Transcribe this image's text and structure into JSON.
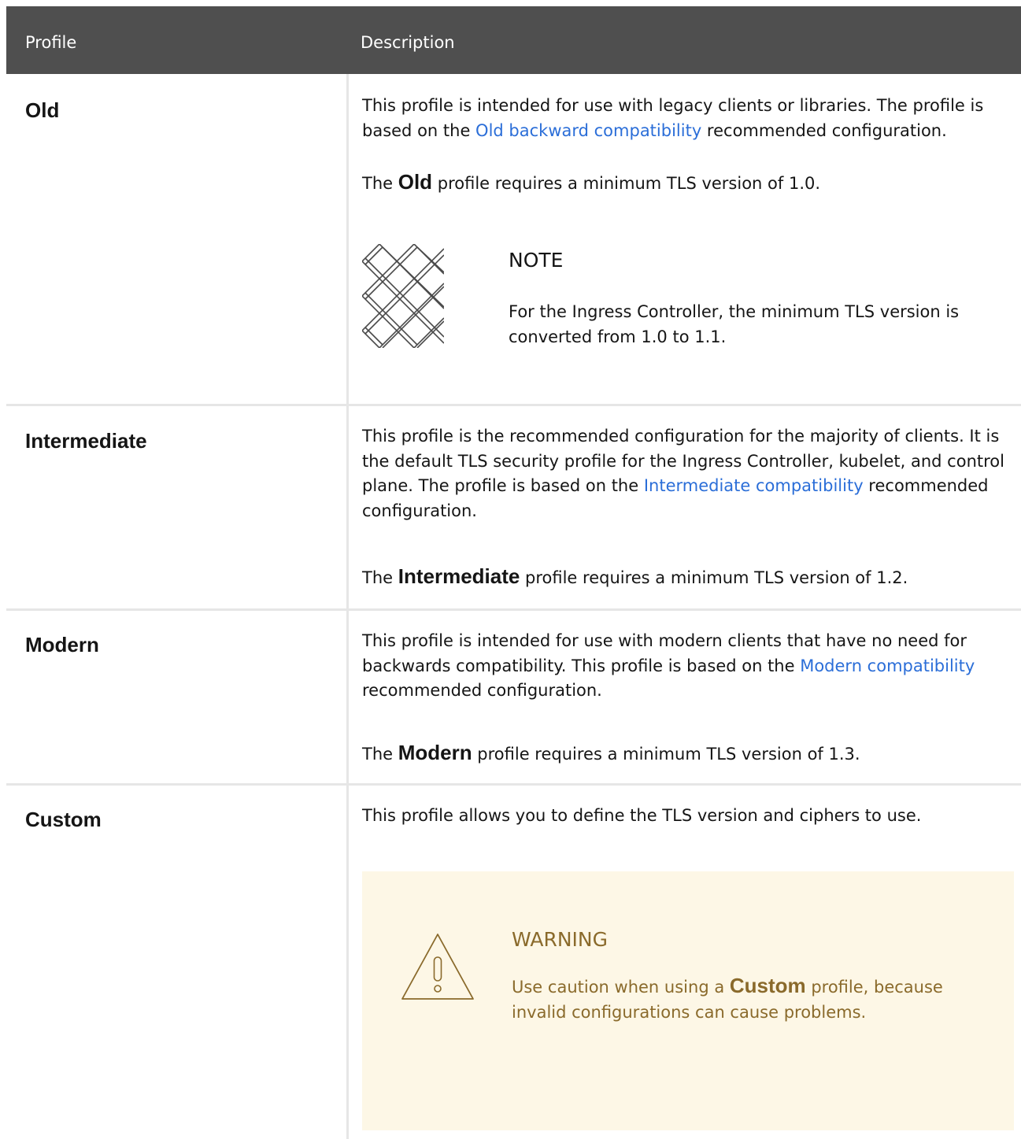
{
  "header": {
    "col_profile": "Profile",
    "col_description": "Description"
  },
  "rows": {
    "old": {
      "name": "Old",
      "p1_before": "This profile is intended for use with legacy clients or libraries. The profile is based on the ",
      "p1_link": "Old backward compatibility",
      "p1_after": " recommended configuration.",
      "p2_before": "The ",
      "p2_bold": "Old",
      "p2_after": " profile requires a minimum TLS version of 1.0.",
      "note": {
        "title": "NOTE",
        "text": "For the Ingress Controller, the minimum TLS version is converted from 1.0 to 1.1."
      }
    },
    "intermediate": {
      "name": "Intermediate",
      "p1_before": "This profile is the recommended configuration for the majority of clients. It is the default TLS security profile for the Ingress Controller, kubelet, and control plane. The profile is based on the ",
      "p1_link": "Intermediate compatibility",
      "p1_after": " recommended configuration.",
      "p2_before": "The ",
      "p2_bold": "Intermediate",
      "p2_after": " profile requires a minimum TLS version of 1.2."
    },
    "modern": {
      "name": "Modern",
      "p1_before": "This profile is intended for use with modern clients that have no need for backwards compatibility. This profile is based on the ",
      "p1_link": "Modern compatibility",
      "p1_after": " recommended configuration.",
      "p2_before": "The ",
      "p2_bold": "Modern",
      "p2_after": " profile requires a minimum TLS version of 1.3."
    },
    "custom": {
      "name": "Custom",
      "p1": "This profile allows you to define the TLS version and ciphers to use.",
      "warning": {
        "title": "WARNING",
        "text_before": "Use caution when using a ",
        "text_bold": "Custom",
        "text_after": " profile, because invalid configurations can cause problems."
      }
    }
  },
  "colors": {
    "header_bg": "#4f4f4f",
    "link": "#2b6ed8",
    "warning_bg": "#fdf7e6",
    "warning_text": "#8a6a2b"
  }
}
